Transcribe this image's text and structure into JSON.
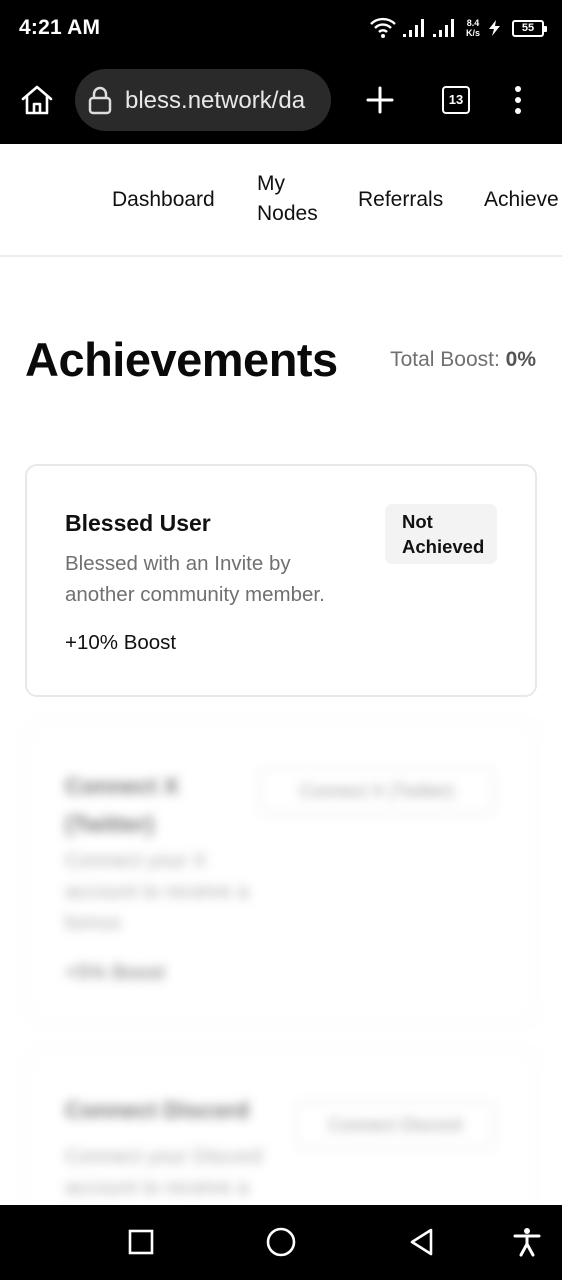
{
  "status_bar": {
    "time": "4:21 AM",
    "net_speed_value": "8.4",
    "net_speed_unit": "K/s",
    "battery": "55",
    "icons": [
      "wifi-icon",
      "signal-icon",
      "signal-icon",
      "charging-icon",
      "battery-icon"
    ]
  },
  "browser": {
    "url": "bless.network/da",
    "tab_count": "13",
    "icons": [
      "home-icon",
      "lock-icon",
      "plus-icon",
      "tabs-icon",
      "menu-icon"
    ]
  },
  "nav": {
    "items": [
      {
        "label": "Dashboard"
      },
      {
        "label": "My Nodes"
      },
      {
        "label": "Referrals"
      },
      {
        "label": "Achieve"
      }
    ]
  },
  "page": {
    "title": "Achievements",
    "total_boost_label": "Total Boost:",
    "total_boost_value": "0%"
  },
  "achievements": [
    {
      "title": "Blessed User",
      "description": "Blessed with an Invite by another community member.",
      "boost": "+10% Boost",
      "status": "Not Achieved"
    },
    {
      "title": "Connect X (Twitter)",
      "description": "Connect your X account to receive a bonus",
      "boost": "+5% Boost",
      "action": "Connect X (Twitter)"
    },
    {
      "title": "Connect Discord",
      "description": "Connect your Discord account to receive a bonus",
      "action": "Connect Discord"
    }
  ],
  "system_nav": {
    "icons": [
      "recents-icon",
      "home-circle-icon",
      "back-icon",
      "accessibility-icon"
    ]
  }
}
